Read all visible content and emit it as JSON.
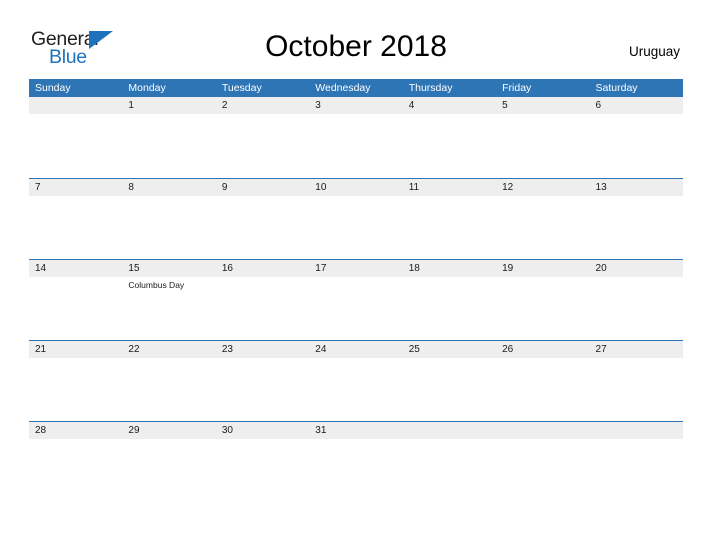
{
  "brand": {
    "name_part1": "General",
    "name_part2": "Blue",
    "triangle_color": "#1e72bb",
    "blue_text_color": "#1f72bd",
    "dark_text_color": "#231f20"
  },
  "header": {
    "title": "October 2018",
    "country": "Uruguay"
  },
  "colors": {
    "header_blue": "#2e75b6",
    "date_band_gray": "#eeeeee",
    "cell_white": "#ffffff",
    "text_dark": "#1a1a1a",
    "header_text": "#ffffff"
  },
  "calendar": {
    "month": "October",
    "year": "2018",
    "weekdays": [
      "Sunday",
      "Monday",
      "Tuesday",
      "Wednesday",
      "Thursday",
      "Friday",
      "Saturday"
    ],
    "weeks": [
      [
        {
          "date": "",
          "events": []
        },
        {
          "date": "1",
          "events": []
        },
        {
          "date": "2",
          "events": []
        },
        {
          "date": "3",
          "events": []
        },
        {
          "date": "4",
          "events": []
        },
        {
          "date": "5",
          "events": []
        },
        {
          "date": "6",
          "events": []
        }
      ],
      [
        {
          "date": "7",
          "events": []
        },
        {
          "date": "8",
          "events": []
        },
        {
          "date": "9",
          "events": []
        },
        {
          "date": "10",
          "events": []
        },
        {
          "date": "11",
          "events": []
        },
        {
          "date": "12",
          "events": []
        },
        {
          "date": "13",
          "events": []
        }
      ],
      [
        {
          "date": "14",
          "events": []
        },
        {
          "date": "15",
          "events": [
            "Columbus Day"
          ]
        },
        {
          "date": "16",
          "events": []
        },
        {
          "date": "17",
          "events": []
        },
        {
          "date": "18",
          "events": []
        },
        {
          "date": "19",
          "events": []
        },
        {
          "date": "20",
          "events": []
        }
      ],
      [
        {
          "date": "21",
          "events": []
        },
        {
          "date": "22",
          "events": []
        },
        {
          "date": "23",
          "events": []
        },
        {
          "date": "24",
          "events": []
        },
        {
          "date": "25",
          "events": []
        },
        {
          "date": "26",
          "events": []
        },
        {
          "date": "27",
          "events": []
        }
      ],
      [
        {
          "date": "28",
          "events": []
        },
        {
          "date": "29",
          "events": []
        },
        {
          "date": "30",
          "events": []
        },
        {
          "date": "31",
          "events": []
        },
        {
          "date": "",
          "events": []
        },
        {
          "date": "",
          "events": []
        },
        {
          "date": "",
          "events": []
        }
      ]
    ]
  }
}
